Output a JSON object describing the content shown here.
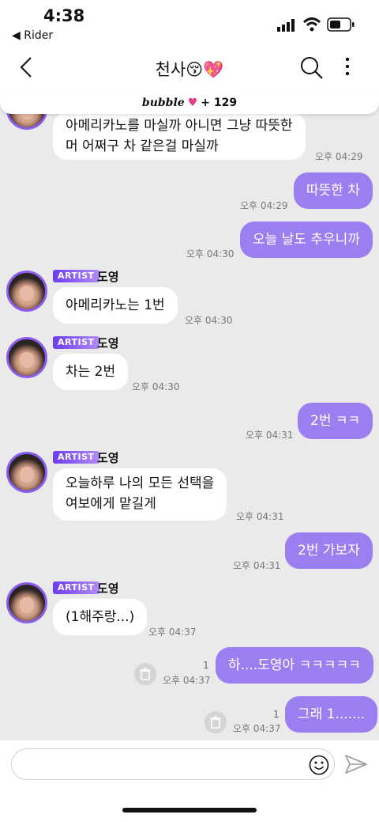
{
  "status": {
    "time": "4:38",
    "back_app": "◀ Rider"
  },
  "header": {
    "title": "천사😚💖"
  },
  "bubble": {
    "logo": "bubble",
    "heart": "♥",
    "count": "+ 129"
  },
  "messages": [
    {
      "lines": [
        "아메리카노를 마실까 아니면 그냥 따뜻한",
        "머 어쩌구 차 같은걸 마실까"
      ],
      "time": "오후 04:29"
    },
    {
      "text": "따뜻한 차",
      "time": "오후 04:29"
    },
    {
      "text": "오늘 날도 추우니까",
      "time": "오후 04:30"
    },
    {
      "badge": "ARTIST",
      "name": "도영",
      "text": "아메리카노는 1번",
      "time": "오후 04:30"
    },
    {
      "badge": "ARTIST",
      "name": "도영",
      "text": "차는 2번",
      "time": "오후 04:30"
    },
    {
      "text": "2번 ㅋㅋ",
      "time": "오후 04:31"
    },
    {
      "badge": "ARTIST",
      "name": "도영",
      "lines": [
        "오늘하루 나의 모든 선택을",
        "여보에게 맡길게"
      ],
      "time": "오후 04:31"
    },
    {
      "text": "2번 가보자",
      "time": "오후 04:31"
    },
    {
      "badge": "ARTIST",
      "name": "도영",
      "text": "(1해주랑...)",
      "time": "오후 04:37"
    },
    {
      "text": "하....도영아 ㅋㅋㅋㅋㅋ",
      "time": "오후 04:37",
      "count": "1"
    },
    {
      "text": "그래 1.......",
      "time": "오후 04:37",
      "count": "1"
    }
  ],
  "colors": {
    "accent": "#9b7ff0",
    "badge": "#6c3cf0",
    "background": "#eaeaea"
  },
  "icons": [
    "back-arrow",
    "search",
    "more-vertical",
    "trash",
    "emoji",
    "send"
  ]
}
